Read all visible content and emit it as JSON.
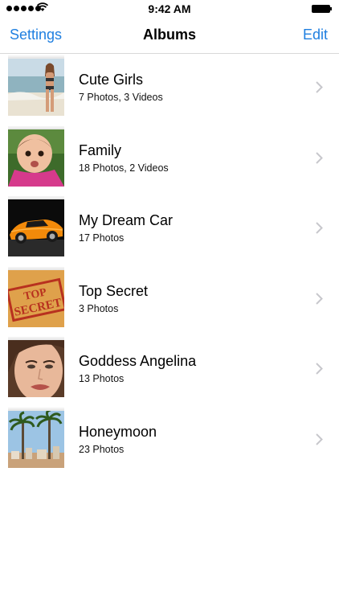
{
  "status_bar": {
    "time": "9:42 AM",
    "signal_dots": 5,
    "icons": [
      "signal-dots-icon",
      "wifi-icon",
      "battery-icon"
    ]
  },
  "nav": {
    "left_label": "Settings",
    "title": "Albums",
    "right_label": "Edit"
  },
  "colors": {
    "accent": "#1f7fe0",
    "divider": "#d9d9d9",
    "chevron": "#c7c7cc"
  },
  "albums": [
    {
      "title": "Cute Girls",
      "subtitle": "7 Photos, 3 Videos",
      "thumb": "beach-person-photo"
    },
    {
      "title": "Family",
      "subtitle": "18 Photos, 2 Videos",
      "thumb": "baby-photo"
    },
    {
      "title": "My Dream Car",
      "subtitle": "17 Photos",
      "thumb": "sports-car-photo"
    },
    {
      "title": "Top Secret",
      "subtitle": "3 Photos",
      "thumb": "top-secret-stamp-photo"
    },
    {
      "title": "Goddess Angelina",
      "subtitle": "13 Photos",
      "thumb": "face-closeup-photo"
    },
    {
      "title": "Honeymoon",
      "subtitle": "23 Photos",
      "thumb": "palm-trees-photo"
    }
  ],
  "thumb_stamp": {
    "line1": "TOP",
    "line2": "SECRET"
  }
}
